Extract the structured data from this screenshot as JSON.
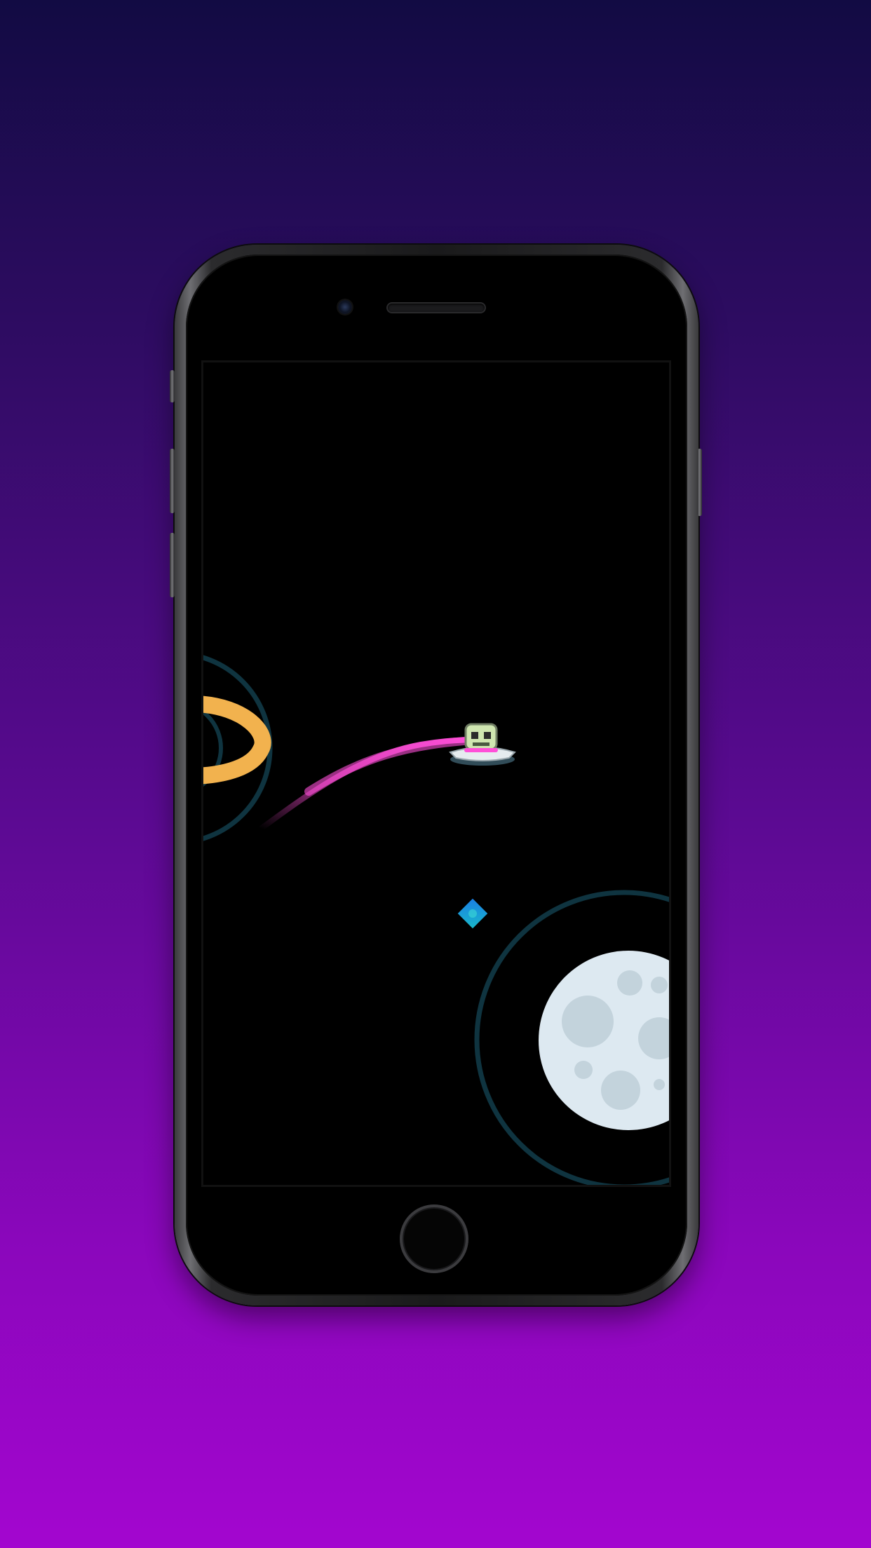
{
  "game": {
    "scene": "space",
    "colors": {
      "background_top": "#120b43",
      "background_bottom": "#a306cf",
      "orbit_ring": "#0f3440",
      "planet_ring": "#f2b24e",
      "trail": "#ff4fd8",
      "gem": "#1aa0e0",
      "moon": "#dde9f1",
      "moon_crater": "#c3d3dc"
    },
    "icons": {
      "player": "ufo-alien-icon",
      "collectible": "diamond-gem-icon",
      "planet": "ringed-planet-icon",
      "moon": "moon-icon"
    }
  }
}
